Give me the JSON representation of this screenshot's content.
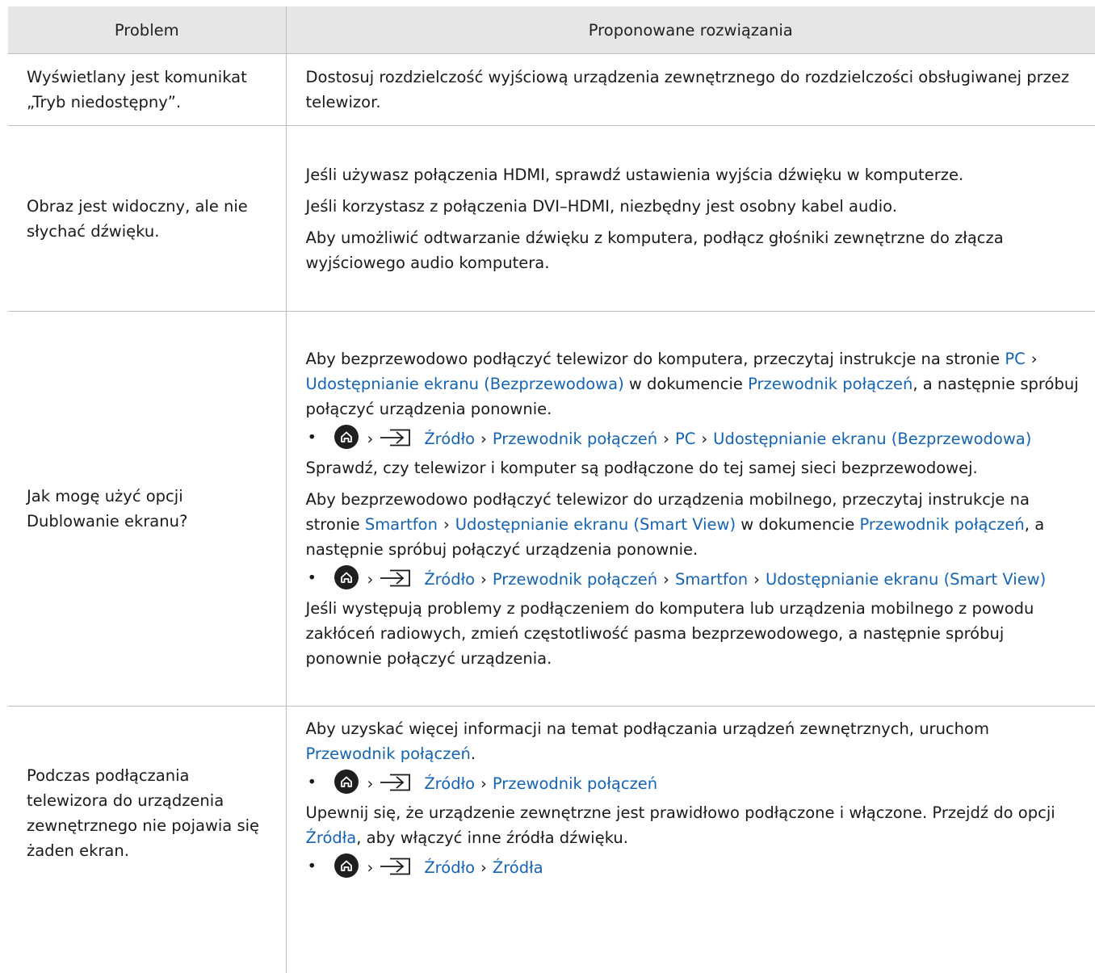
{
  "header": {
    "problem": "Problem",
    "solutions": "Proponowane rozwiązania"
  },
  "rows": [
    {
      "problem": "Wyświetlany jest komunikat „Tryb niedostępny”.",
      "p1": "Dostosuj rozdzielczość wyjściową urządzenia zewnętrznego do rozdzielczości obsługiwanej przez telewizor."
    },
    {
      "problem": "Obraz jest widoczny, ale nie słychać dźwięku.",
      "p1": "Jeśli używasz połączenia HDMI, sprawdź ustawienia wyjścia dźwięku w komputerze.",
      "p2": "Jeśli korzystasz z połączenia DVI–HDMI, niezbędny jest osobny kabel audio.",
      "p3": "Aby umożliwić odtwarzanie dźwięku z komputera, podłącz głośniki zewnętrzne do złącza wyjściowego audio komputera."
    },
    {
      "problem": "Jak mogę użyć opcji Dublowanie ekranu?",
      "p1a": "Aby bezprzewodowo podłączyć telewizor do komputera, przeczytaj instrukcje na stronie",
      "p1_link1": "PC",
      "p1_link2": "Udostępnianie ekranu (Bezprzewodowa)",
      "p1b": "w dokumencie",
      "p1_link3": "Przewodnik połączeń",
      "p1c": ", a następnie spróbuj połączyć urządzenia ponownie.",
      "b1": [
        "Źródło",
        "Przewodnik połączeń",
        "PC",
        "Udostępnianie ekranu (Bezprzewodowa)"
      ],
      "p2": "Sprawdź, czy telewizor i komputer są podłączone do tej samej sieci bezprzewodowej.",
      "p3a": "Aby bezprzewodowo podłączyć telewizor do urządzenia mobilnego, przeczytaj instrukcje na stronie",
      "p3_link1": "Smartfon",
      "p3_link2": "Udostępnianie ekranu (Smart View)",
      "p3b": "w dokumencie",
      "p3_link3": "Przewodnik połączeń",
      "p3c": ", a następnie spróbuj połączyć urządzenia ponownie.",
      "b2": [
        "Źródło",
        "Przewodnik połączeń",
        "Smartfon",
        "Udostępnianie ekranu (Smart View)"
      ],
      "p4": "Jeśli występują problemy z podłączeniem do komputera lub urządzenia mobilnego z powodu zakłóceń radiowych, zmień częstotliwość pasma bezprzewodowego, a następnie spróbuj ponownie połączyć urządzenia."
    },
    {
      "problem": "Podczas podłączania telewizora do urządzenia zewnętrznego nie pojawia się żaden ekran.",
      "p1a": "Aby uzyskać więcej informacji na temat podłączania urządzeń zewnętrznych, uruchom",
      "p1_link": "Przewodnik połączeń",
      "p1b": ".",
      "b1": [
        "Źródło",
        "Przewodnik połączeń"
      ],
      "p2a": "Upewnij się, że urządzenie zewnętrzne jest prawidłowo podłączone i włączone. Przejdź do opcji",
      "p2_link": "Źródła",
      "p2b": ", aby włączyć inne źródła dźwięku.",
      "b2": [
        "Źródło",
        "Źródła"
      ]
    }
  ],
  "icons": {
    "home": "home-icon",
    "source": "source-input-icon",
    "chevron": "›",
    "bullet": "•"
  },
  "colors": {
    "link": "#1464b4",
    "header_bg": "#e6e6e6",
    "rule": "#bdbdbd"
  }
}
